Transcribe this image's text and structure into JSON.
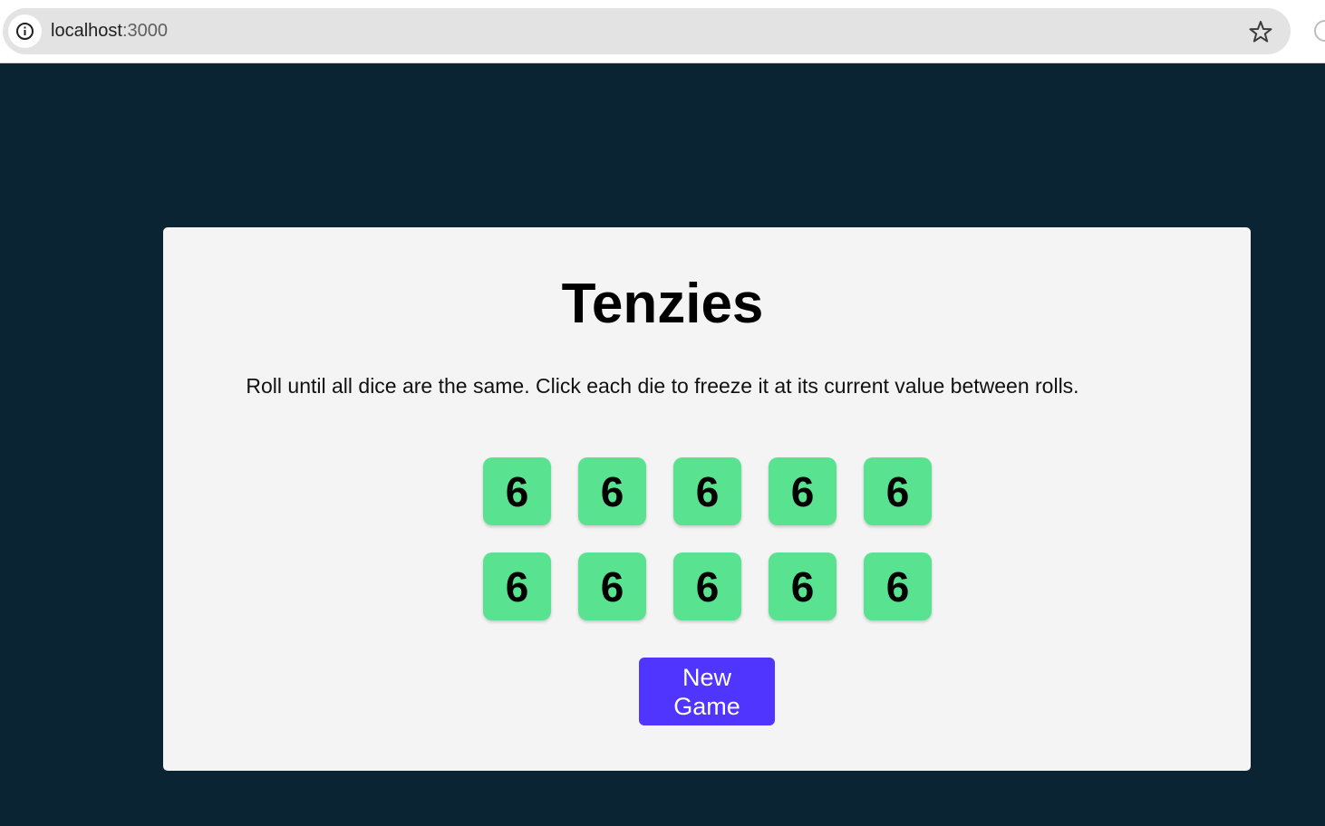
{
  "browser": {
    "url_host": "localhost",
    "url_port": ":3000",
    "info_icon": "info-icon",
    "bookmark_icon": "star-icon"
  },
  "game": {
    "title": "Tenzies",
    "instructions": "Roll until all dice are the same. Click each die to freeze it at its current value between rolls.",
    "dice": [
      {
        "value": "6",
        "held": true
      },
      {
        "value": "6",
        "held": true
      },
      {
        "value": "6",
        "held": true
      },
      {
        "value": "6",
        "held": true
      },
      {
        "value": "6",
        "held": true
      },
      {
        "value": "6",
        "held": true
      },
      {
        "value": "6",
        "held": true
      },
      {
        "value": "6",
        "held": true
      },
      {
        "value": "6",
        "held": true
      },
      {
        "value": "6",
        "held": true
      }
    ],
    "button_label": "New Game"
  },
  "colors": {
    "background": "#0b2434",
    "card": "#f4f4f4",
    "die_held": "#59e391",
    "button": "#5035ff"
  }
}
